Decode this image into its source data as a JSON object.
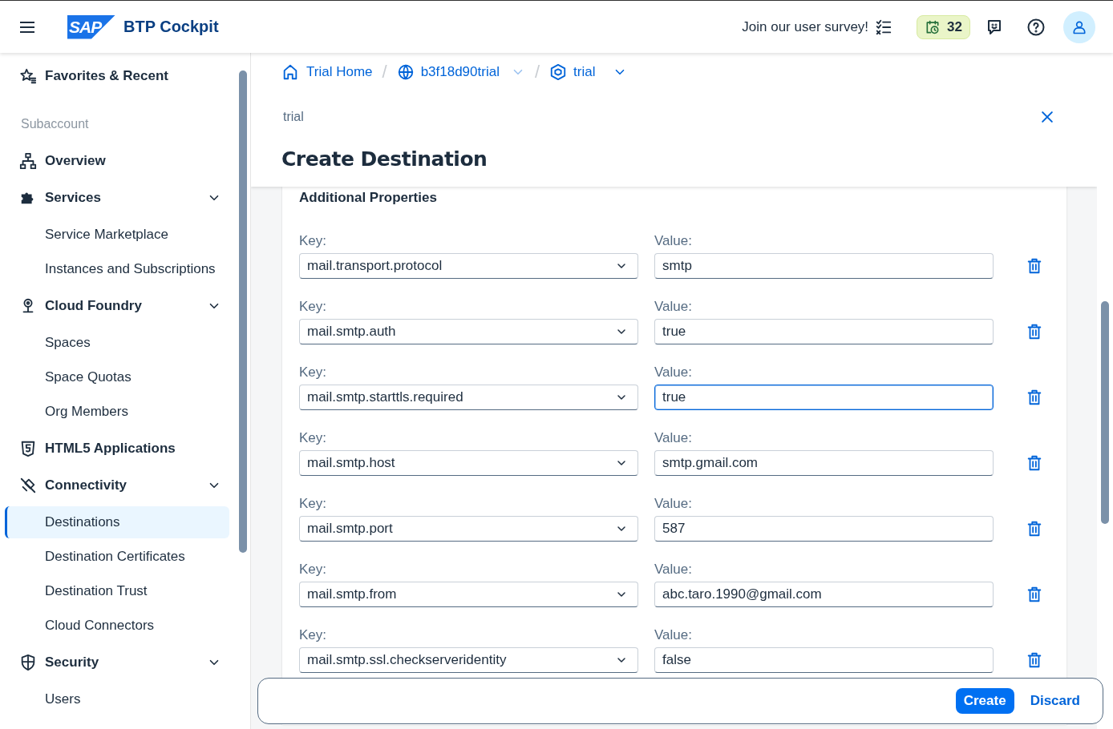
{
  "header": {
    "logo": "SAP",
    "title": "BTP Cockpit",
    "survey": "Join our user survey!",
    "badge": "32"
  },
  "sidebar": {
    "favorites": "Favorites & Recent",
    "section": "Subaccount",
    "items": [
      {
        "label": "Overview",
        "kind": "overview"
      },
      {
        "label": "Services",
        "kind": "services",
        "expanded": true,
        "children": [
          {
            "label": "Service Marketplace",
            "selected": false
          },
          {
            "label": "Instances and Subscriptions",
            "selected": false
          }
        ]
      },
      {
        "label": "Cloud Foundry",
        "kind": "cloud",
        "expanded": true,
        "children": [
          {
            "label": "Spaces",
            "selected": false
          },
          {
            "label": "Space Quotas",
            "selected": false
          },
          {
            "label": "Org Members",
            "selected": false
          }
        ]
      },
      {
        "label": "HTML5 Applications",
        "kind": "html5"
      },
      {
        "label": "Connectivity",
        "kind": "connectivity",
        "expanded": true,
        "children": [
          {
            "label": "Destinations",
            "selected": true
          },
          {
            "label": "Destination Certificates",
            "selected": false
          },
          {
            "label": "Destination Trust",
            "selected": false
          },
          {
            "label": "Cloud Connectors",
            "selected": false
          }
        ]
      },
      {
        "label": "Security",
        "kind": "security",
        "expanded": true,
        "children": [
          {
            "label": "Users",
            "selected": false
          }
        ]
      }
    ]
  },
  "breadcrumb": [
    {
      "label": "Trial Home",
      "kind": "home",
      "dropdown": false
    },
    {
      "separator": "/",
      "label": "b3f18d90trial",
      "kind": "globe",
      "dropdown": true
    },
    {
      "separator": "/",
      "label": "trial",
      "kind": "cube",
      "dropdown": true
    }
  ],
  "page": {
    "subtitle": "trial",
    "title": "Create Destination"
  },
  "section": {
    "title": "Additional Properties",
    "rows": [
      {
        "key_label": "Key:",
        "key": "mail.transport.protocol",
        "value_label": "Value:",
        "value": "smtp",
        "focused": false
      },
      {
        "key_label": "Key:",
        "key": "mail.smtp.auth",
        "value_label": "Value:",
        "value": "true",
        "focused": false
      },
      {
        "key_label": "Key:",
        "key": "mail.smtp.starttls.required",
        "value_label": "Value:",
        "value": "true",
        "focused": true
      },
      {
        "key_label": "Key:",
        "key": "mail.smtp.host",
        "value_label": "Value:",
        "value": "smtp.gmail.com",
        "focused": false
      },
      {
        "key_label": "Key:",
        "key": "mail.smtp.port",
        "value_label": "Value:",
        "value": "587",
        "focused": false
      },
      {
        "key_label": "Key:",
        "key": "mail.smtp.from",
        "value_label": "Value:",
        "value": "abc.taro.1990@gmail.com",
        "focused": false
      },
      {
        "key_label": "Key:",
        "key": "mail.smtp.ssl.checkserveridentity",
        "value_label": "Value:",
        "value": "false",
        "focused": false
      }
    ]
  },
  "footer": {
    "buttons": [
      {
        "label": "Create",
        "kind": "primary"
      },
      {
        "label": "Discard",
        "kind": "transparent"
      }
    ]
  }
}
